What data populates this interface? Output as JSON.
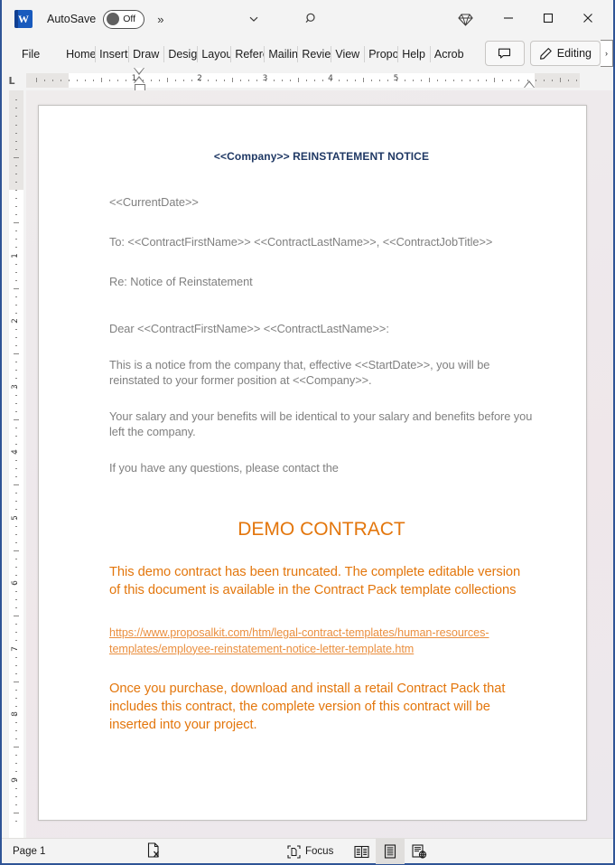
{
  "titlebar": {
    "app_icon": "word-logo",
    "app_initial": "W",
    "autosave_label": "AutoSave",
    "autosave_state": "Off",
    "more_commands": "»",
    "customize_icon": "chevron-down-icon",
    "search_icon": "search-icon",
    "premium_icon": "diamond-icon",
    "minimize": "─",
    "maximize": "□",
    "close": "✕"
  },
  "ribbon": {
    "tabs": [
      {
        "label": "File",
        "full": "File"
      },
      {
        "label": "Home",
        "full": "Home"
      },
      {
        "label": "Insert",
        "full": "Insert"
      },
      {
        "label": "Draw",
        "full": "Draw"
      },
      {
        "label": "Design",
        "full": "Design"
      },
      {
        "label": "Layout",
        "full": "Layout"
      },
      {
        "label": "References",
        "full": "References"
      },
      {
        "label": "Mailings",
        "full": "Mailings"
      },
      {
        "label": "Review",
        "full": "Review"
      },
      {
        "label": "View",
        "full": "View"
      },
      {
        "label": "Proposal Kit",
        "full": "Proposal Kit"
      },
      {
        "label": "Help",
        "full": "Help"
      },
      {
        "label": "Acrobat",
        "full": "Acrobat"
      }
    ],
    "comments_icon": "comment-icon",
    "editing_label": "Editing",
    "editing_icon": "pencil-icon",
    "editing_caret": "›"
  },
  "ruler": {
    "tabstop_marker": "L",
    "h_numbers": [
      1,
      2,
      3,
      4,
      5
    ],
    "v_numbers": [
      1,
      2,
      3,
      4,
      5,
      6,
      7,
      8,
      9
    ],
    "units": "inches"
  },
  "document": {
    "title": "<<Company>> REINSTATEMENT NOTICE",
    "title_color": "#1f3864",
    "paragraphs": [
      "<<CurrentDate>>",
      "To: <<ContractFirstName>> <<ContractLastName>>, <<ContractJobTitle>>",
      "Re: Notice of Reinstatement",
      "Dear <<ContractFirstName>> <<ContractLastName>>:",
      "This is a notice from the company that, effective <<StartDate>>, you will be reinstated to your former position at <<Company>>.",
      "Your salary and your benefits will be identical to your salary and benefits before you left the company.",
      "If you have any questions, please contact the"
    ],
    "demo_heading": "DEMO CONTRACT",
    "demo_color": "#e3760c",
    "demo_paragraph_1": "This demo contract has been truncated. The complete editable version of this document is available in the Contract Pack template collections",
    "demo_link": "https://www.proposalkit.com/htm/legal-contract-templates/human-resources-templates/employee-reinstatement-notice-letter-template.htm",
    "demo_paragraph_2": "Once you purchase, download and install a retail Contract Pack that includes this contract, the complete version of this contract will be inserted into your project."
  },
  "statusbar": {
    "page_label": "Page 1",
    "proofing_icon": "proofing-errors-icon",
    "focus_label": "Focus",
    "focus_icon": "focus-icon",
    "views": [
      {
        "name": "read-mode",
        "label": "Read Mode",
        "active": false
      },
      {
        "name": "print-layout",
        "label": "Print Layout",
        "active": true
      },
      {
        "name": "web-layout",
        "label": "Web Layout",
        "active": false
      }
    ]
  },
  "colors": {
    "window_border": "#2f5496",
    "chrome": "#f3f3f3",
    "accent_orange": "#e3760c",
    "title_navy": "#1f3864",
    "body_gray": "#808080"
  }
}
